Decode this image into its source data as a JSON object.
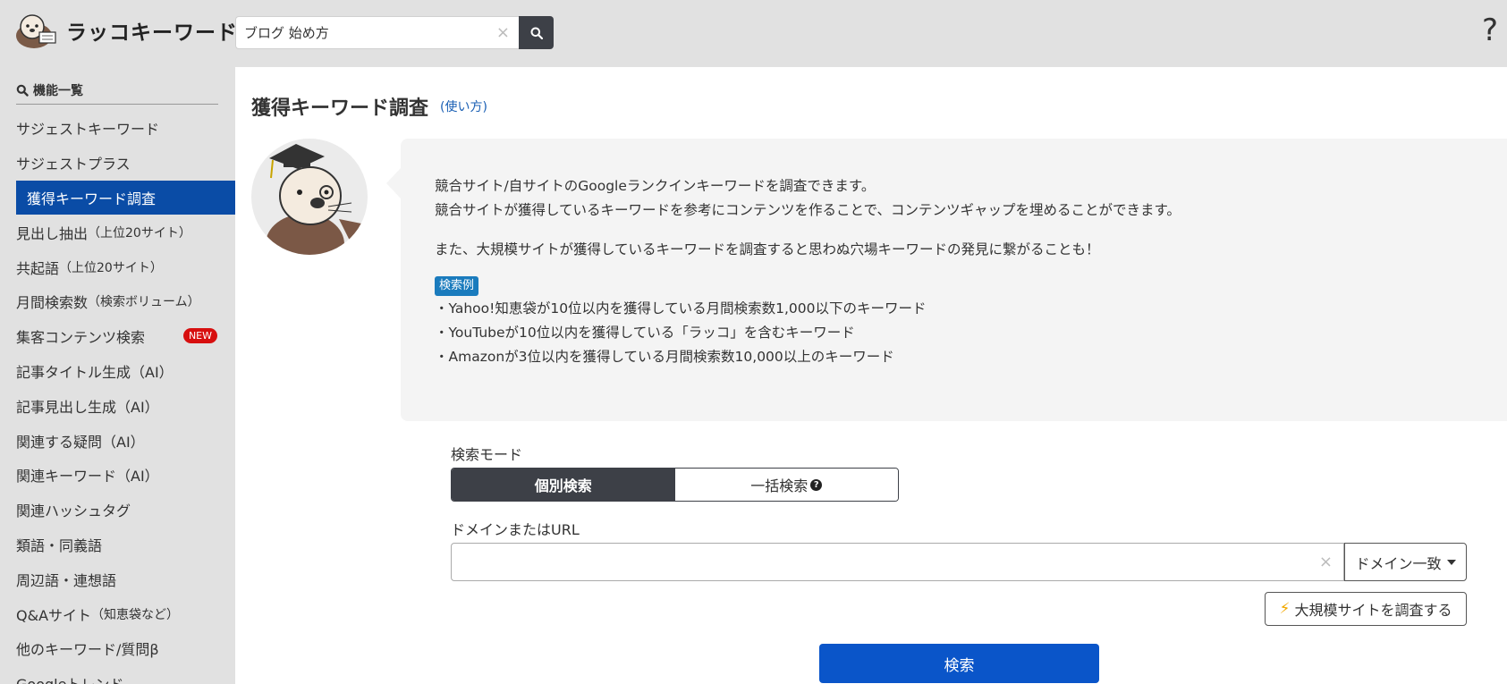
{
  "header": {
    "logo_text": "ラッコキーワード",
    "search_value": "ブログ 始め方",
    "search_clear": "×",
    "help_label": "?"
  },
  "sidebar": {
    "title": "機能一覧",
    "items": [
      {
        "label": "サジェストキーワード",
        "paren": ""
      },
      {
        "label": "サジェストプラス",
        "paren": ""
      },
      {
        "label": "獲得キーワード調査",
        "paren": ""
      },
      {
        "label": "見出し抽出",
        "paren": "（上位20サイト）"
      },
      {
        "label": "共起語",
        "paren": "（上位20サイト）"
      },
      {
        "label": "月間検索数",
        "paren": "（検索ボリューム）"
      },
      {
        "label": "集客コンテンツ検索",
        "paren": "",
        "badge": "NEW"
      },
      {
        "label": "記事タイトル生成（AI）",
        "paren": ""
      },
      {
        "label": "記事見出し生成（AI）",
        "paren": ""
      },
      {
        "label": "関連する疑問（AI）",
        "paren": ""
      },
      {
        "label": "関連キーワード（AI）",
        "paren": ""
      },
      {
        "label": "関連ハッシュタグ",
        "paren": ""
      },
      {
        "label": "類語・同義語",
        "paren": ""
      },
      {
        "label": "周辺語・連想語",
        "paren": ""
      },
      {
        "label": "Q&Aサイト",
        "paren": "（知恵袋など）"
      },
      {
        "label": "他のキーワード/質問β",
        "paren": ""
      },
      {
        "label": "Googleトレンド",
        "paren": ""
      }
    ]
  },
  "main": {
    "title": "獲得キーワード調査",
    "howto": "(使い方)",
    "intro": {
      "line1": "競合サイト/自サイトのGoogleランクインキーワードを調査できます。",
      "line2": "競合サイトが獲得しているキーワードを参考にコンテンツを作ることで、コンテンツギャップを埋めることができます。",
      "line3": "また、大規模サイトが獲得しているキーワードを調査すると思わぬ穴場キーワードの発見に繋がることも！",
      "example_badge": "検索例",
      "examples": [
        "・Yahoo!知恵袋が10位以内を獲得している月間検索数1,000以下のキーワード",
        "・YouTubeが10位以内を獲得している「ラッコ」を含むキーワード",
        "・Amazonが3位以内を獲得している月間検索数10,000以上のキーワード"
      ]
    },
    "form": {
      "mode_label": "検索モード",
      "mode_single": "個別検索",
      "mode_bulk": "一括検索",
      "mode_help": "?",
      "url_label": "ドメインまたはURL",
      "url_value": "",
      "url_clear": "×",
      "match_option": "ドメイン一致",
      "bigsite_label": "大規模サイトを調査する",
      "submit_label": "検索"
    }
  },
  "colors": {
    "accent": "#0a55c9",
    "sidebar_active": "#0a4ca6",
    "new_badge": "#d70f0f",
    "dark": "#3d4047"
  }
}
